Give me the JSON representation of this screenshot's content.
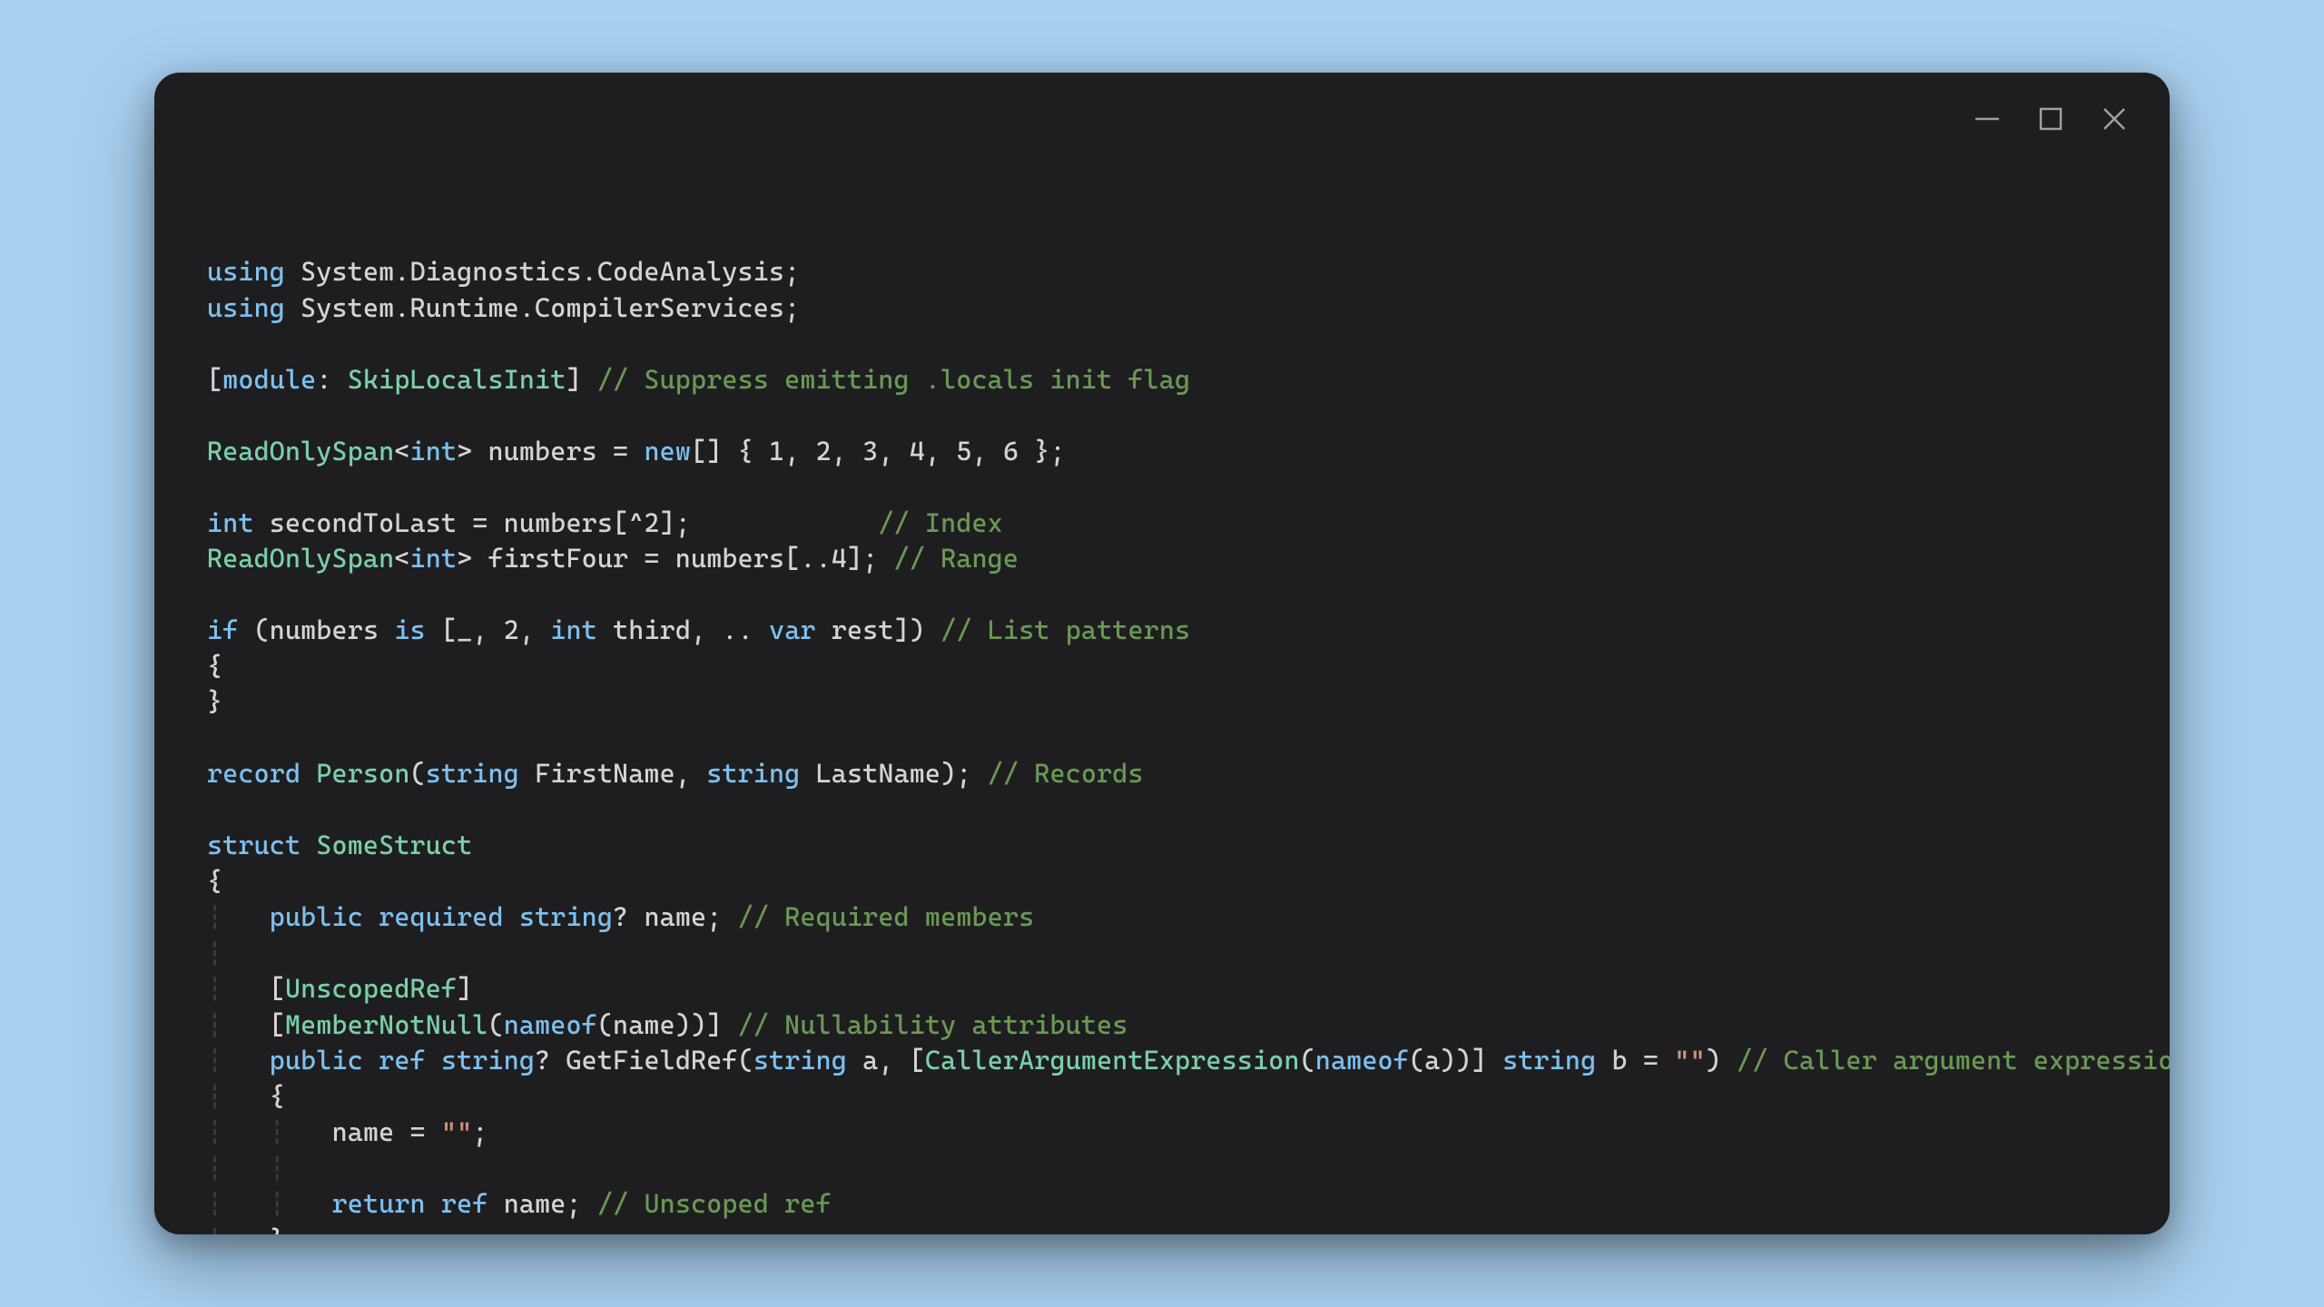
{
  "code": {
    "l01_using": "using",
    "l01_ns": "System.Diagnostics.CodeAnalysis",
    "l02_using": "using",
    "l02_ns": "System.Runtime.CompilerServices",
    "l04_module": "module",
    "l04_attr": "SkipLocalsInit",
    "l04_cmt": "// Suppress emitting .locals init flag",
    "l06_type1": "ReadOnlySpan",
    "l06_int": "int",
    "l06_numbers": "numbers",
    "l06_eq": "=",
    "l06_new": "new",
    "l06_arr": "[] { 1, 2, 3, 4, 5, 6 }",
    "l08_int": "int",
    "l08_var": "secondToLast",
    "l08_rhs": "= numbers[^2];",
    "l08_cmt": "// Index",
    "l09_type": "ReadOnlySpan",
    "l09_int": "int",
    "l09_var": "firstFour",
    "l09_rhs": "= numbers[..4];",
    "l09_cmt": "// Range",
    "l11_if": "if",
    "l11_numbers": "(numbers",
    "l11_is": "is",
    "l11_pat_open": "[_, 2,",
    "l11_int": "int",
    "l11_third": "third, ..",
    "l11_var": "var",
    "l11_rest": "rest])",
    "l11_cmt": "// List patterns",
    "l12_brace": "{",
    "l13_brace": "}",
    "l15_record": "record",
    "l15_person": "Person",
    "l15_string1": "string",
    "l15_fn": "FirstName,",
    "l15_string2": "string",
    "l15_ln": "LastName);",
    "l15_cmt": "// Records",
    "l17_struct": "struct",
    "l17_name": "SomeStruct",
    "l18_brace": "{",
    "l19_public": "public",
    "l19_required": "required",
    "l19_string": "string",
    "l19_q": "?",
    "l19_name": "name;",
    "l19_cmt": "// Required members",
    "l21_attr": "UnscopedRef",
    "l22_attr": "MemberNotNull",
    "l22_nameof": "nameof",
    "l22_arg": "(name))]",
    "l22_cmt": "// Nullability attributes",
    "l23_public": "public",
    "l23_ref": "ref",
    "l23_string": "string",
    "l23_q": "?",
    "l23_method": "GetFieldRef",
    "l23_string2": "string",
    "l23_a": "a, [",
    "l23_cae": "CallerArgumentExpression",
    "l23_nameof": "nameof",
    "l23_ap": "(a))]",
    "l23_string3": "string",
    "l23_b": "b =",
    "l23_empty": "\"\"",
    "l23_close": ")",
    "l23_cmt": "// Caller argument expressions",
    "l24_brace": "{",
    "l25_assign": "name =",
    "l25_empty": "\"\"",
    "l25_semi": ";",
    "l27_return": "return",
    "l27_ref": "ref",
    "l27_name": "name;",
    "l27_cmt": "// Unscoped ref",
    "l28_brace": "}",
    "l29_brace": "}"
  }
}
